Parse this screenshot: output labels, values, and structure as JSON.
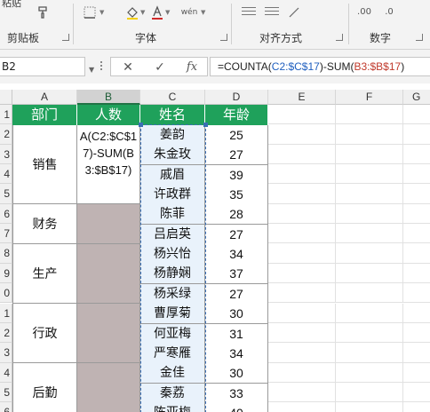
{
  "ribbon": {
    "top_fragment": "粘贴",
    "groups": {
      "clipboard": "剪贴板",
      "font": "字体",
      "alignment": "对齐方式",
      "number": "数字"
    }
  },
  "formula_bar": {
    "name_box": "B2",
    "fx_label": "fx",
    "formula_parts": [
      "=COUNTA(",
      "C2:$C$17",
      ")-SUM(",
      "B3:$B$17",
      ")"
    ]
  },
  "columns": [
    "A",
    "B",
    "C",
    "D",
    "E",
    "F",
    "G"
  ],
  "rows": [
    "1",
    "2",
    "3",
    "4",
    "5",
    "6",
    "7",
    "8",
    "9",
    "0",
    "1",
    "2",
    "3",
    "4",
    "5",
    "6"
  ],
  "headers": [
    "部门",
    "人数",
    "姓名",
    "年龄"
  ],
  "b2_value": "A(C2:$C$17)-SUM(B3:$B$17)",
  "departments": [
    "销售",
    "财务",
    "生产",
    "行政",
    "后勤"
  ],
  "names": [
    "姜韵",
    "朱金玫",
    "戚眉",
    "许政群",
    "陈菲",
    "吕启英",
    "杨兴怡",
    "杨静娴",
    "杨采绿",
    "曹厚菊",
    "何亚梅",
    "严寒雁",
    "金佳",
    "秦荔",
    "陈亚梅"
  ],
  "ages": [
    "25",
    "27",
    "39",
    "35",
    "28",
    "27",
    "34",
    "37",
    "27",
    "30",
    "31",
    "34",
    "30",
    "33",
    "40"
  ],
  "colors": {
    "header_green": "#1fa15b",
    "merged_gray": "#bfb3b3",
    "name_fill": "#e9f2fb",
    "selection_green": "#217346"
  },
  "icons": [
    "format-painter-icon",
    "borders-icon",
    "fill-color-icon",
    "font-color-icon",
    "wrap-text-icon",
    "decrease-indent-icon",
    "increase-indent-icon",
    "number-format-icon",
    "cancel-icon",
    "enter-icon",
    "function-icon"
  ]
}
